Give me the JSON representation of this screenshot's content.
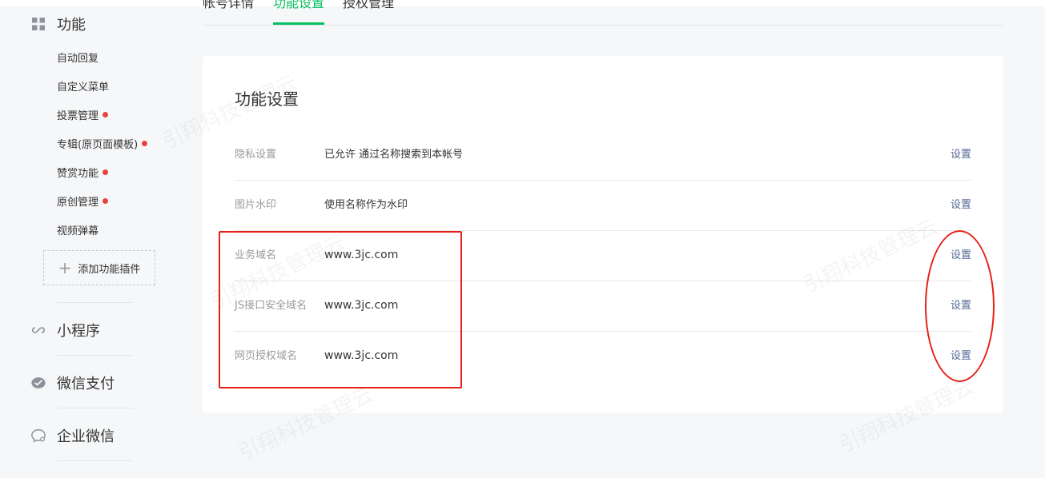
{
  "tabs": [
    {
      "label": "帐号详情"
    },
    {
      "label": "功能设置"
    },
    {
      "label": "授权管理"
    }
  ],
  "sidebar": {
    "function_group": {
      "label": "功能",
      "icon": "grid-icon",
      "items": [
        {
          "label": "自动回复",
          "badge": false
        },
        {
          "label": "自定义菜单",
          "badge": false
        },
        {
          "label": "投票管理",
          "badge": true
        },
        {
          "label": "专辑(原页面模板)",
          "badge": true
        },
        {
          "label": "赞赏功能",
          "badge": true
        },
        {
          "label": "原创管理",
          "badge": true
        },
        {
          "label": "视频弹幕",
          "badge": false
        }
      ],
      "add_plugin_label": "添加功能插件"
    },
    "mini_program": {
      "label": "小程序",
      "icon": "link-icon"
    },
    "wechat_pay": {
      "label": "微信支付",
      "icon": "wechat-pay-icon"
    },
    "work_wechat": {
      "label": "企业微信",
      "icon": "chat-bubble-icon"
    }
  },
  "card": {
    "title": "功能设置",
    "rows": [
      {
        "label": "隐私设置",
        "value": "已允许 通过名称搜索到本帐号",
        "action": "设置"
      },
      {
        "label": "图片水印",
        "value": "使用名称作为水印",
        "action": "设置"
      },
      {
        "label": "业务域名",
        "value": "www.3jc.com",
        "action": "设置"
      },
      {
        "label": "JS接口安全域名",
        "value": "www.3jc.com",
        "action": "设置"
      },
      {
        "label": "网页授权域名",
        "value": "www.3jc.com",
        "action": "设置"
      }
    ]
  },
  "watermark": "引翔科技管理云",
  "colors": {
    "accent": "#07c160",
    "badge": "#e64340",
    "link": "#576b95",
    "annotation": "#e62117"
  }
}
